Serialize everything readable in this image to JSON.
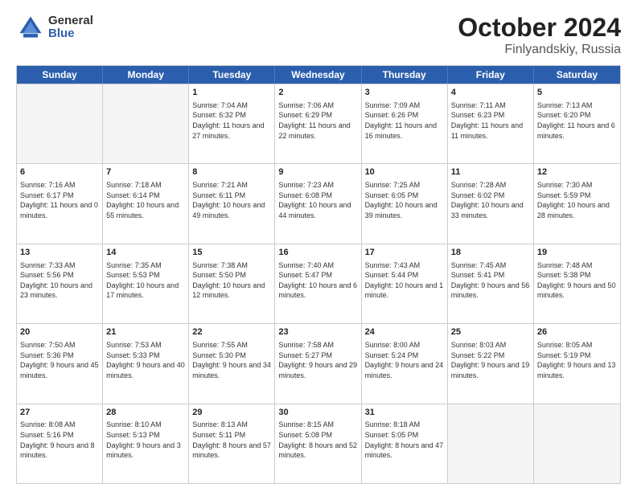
{
  "logo": {
    "general": "General",
    "blue": "Blue"
  },
  "title": {
    "month": "October 2024",
    "location": "Finlyandskiy, Russia"
  },
  "header_days": [
    "Sunday",
    "Monday",
    "Tuesday",
    "Wednesday",
    "Thursday",
    "Friday",
    "Saturday"
  ],
  "rows": [
    [
      {
        "day": "",
        "sunrise": "",
        "sunset": "",
        "daylight": "",
        "empty": true
      },
      {
        "day": "",
        "sunrise": "",
        "sunset": "",
        "daylight": "",
        "empty": true
      },
      {
        "day": "1",
        "sunrise": "Sunrise: 7:04 AM",
        "sunset": "Sunset: 6:32 PM",
        "daylight": "Daylight: 11 hours and 27 minutes.",
        "empty": false
      },
      {
        "day": "2",
        "sunrise": "Sunrise: 7:06 AM",
        "sunset": "Sunset: 6:29 PM",
        "daylight": "Daylight: 11 hours and 22 minutes.",
        "empty": false
      },
      {
        "day": "3",
        "sunrise": "Sunrise: 7:09 AM",
        "sunset": "Sunset: 6:26 PM",
        "daylight": "Daylight: 11 hours and 16 minutes.",
        "empty": false
      },
      {
        "day": "4",
        "sunrise": "Sunrise: 7:11 AM",
        "sunset": "Sunset: 6:23 PM",
        "daylight": "Daylight: 11 hours and 11 minutes.",
        "empty": false
      },
      {
        "day": "5",
        "sunrise": "Sunrise: 7:13 AM",
        "sunset": "Sunset: 6:20 PM",
        "daylight": "Daylight: 11 hours and 6 minutes.",
        "empty": false
      }
    ],
    [
      {
        "day": "6",
        "sunrise": "Sunrise: 7:16 AM",
        "sunset": "Sunset: 6:17 PM",
        "daylight": "Daylight: 11 hours and 0 minutes.",
        "empty": false
      },
      {
        "day": "7",
        "sunrise": "Sunrise: 7:18 AM",
        "sunset": "Sunset: 6:14 PM",
        "daylight": "Daylight: 10 hours and 55 minutes.",
        "empty": false
      },
      {
        "day": "8",
        "sunrise": "Sunrise: 7:21 AM",
        "sunset": "Sunset: 6:11 PM",
        "daylight": "Daylight: 10 hours and 49 minutes.",
        "empty": false
      },
      {
        "day": "9",
        "sunrise": "Sunrise: 7:23 AM",
        "sunset": "Sunset: 6:08 PM",
        "daylight": "Daylight: 10 hours and 44 minutes.",
        "empty": false
      },
      {
        "day": "10",
        "sunrise": "Sunrise: 7:25 AM",
        "sunset": "Sunset: 6:05 PM",
        "daylight": "Daylight: 10 hours and 39 minutes.",
        "empty": false
      },
      {
        "day": "11",
        "sunrise": "Sunrise: 7:28 AM",
        "sunset": "Sunset: 6:02 PM",
        "daylight": "Daylight: 10 hours and 33 minutes.",
        "empty": false
      },
      {
        "day": "12",
        "sunrise": "Sunrise: 7:30 AM",
        "sunset": "Sunset: 5:59 PM",
        "daylight": "Daylight: 10 hours and 28 minutes.",
        "empty": false
      }
    ],
    [
      {
        "day": "13",
        "sunrise": "Sunrise: 7:33 AM",
        "sunset": "Sunset: 5:56 PM",
        "daylight": "Daylight: 10 hours and 23 minutes.",
        "empty": false
      },
      {
        "day": "14",
        "sunrise": "Sunrise: 7:35 AM",
        "sunset": "Sunset: 5:53 PM",
        "daylight": "Daylight: 10 hours and 17 minutes.",
        "empty": false
      },
      {
        "day": "15",
        "sunrise": "Sunrise: 7:38 AM",
        "sunset": "Sunset: 5:50 PM",
        "daylight": "Daylight: 10 hours and 12 minutes.",
        "empty": false
      },
      {
        "day": "16",
        "sunrise": "Sunrise: 7:40 AM",
        "sunset": "Sunset: 5:47 PM",
        "daylight": "Daylight: 10 hours and 6 minutes.",
        "empty": false
      },
      {
        "day": "17",
        "sunrise": "Sunrise: 7:43 AM",
        "sunset": "Sunset: 5:44 PM",
        "daylight": "Daylight: 10 hours and 1 minute.",
        "empty": false
      },
      {
        "day": "18",
        "sunrise": "Sunrise: 7:45 AM",
        "sunset": "Sunset: 5:41 PM",
        "daylight": "Daylight: 9 hours and 56 minutes.",
        "empty": false
      },
      {
        "day": "19",
        "sunrise": "Sunrise: 7:48 AM",
        "sunset": "Sunset: 5:38 PM",
        "daylight": "Daylight: 9 hours and 50 minutes.",
        "empty": false
      }
    ],
    [
      {
        "day": "20",
        "sunrise": "Sunrise: 7:50 AM",
        "sunset": "Sunset: 5:36 PM",
        "daylight": "Daylight: 9 hours and 45 minutes.",
        "empty": false
      },
      {
        "day": "21",
        "sunrise": "Sunrise: 7:53 AM",
        "sunset": "Sunset: 5:33 PM",
        "daylight": "Daylight: 9 hours and 40 minutes.",
        "empty": false
      },
      {
        "day": "22",
        "sunrise": "Sunrise: 7:55 AM",
        "sunset": "Sunset: 5:30 PM",
        "daylight": "Daylight: 9 hours and 34 minutes.",
        "empty": false
      },
      {
        "day": "23",
        "sunrise": "Sunrise: 7:58 AM",
        "sunset": "Sunset: 5:27 PM",
        "daylight": "Daylight: 9 hours and 29 minutes.",
        "empty": false
      },
      {
        "day": "24",
        "sunrise": "Sunrise: 8:00 AM",
        "sunset": "Sunset: 5:24 PM",
        "daylight": "Daylight: 9 hours and 24 minutes.",
        "empty": false
      },
      {
        "day": "25",
        "sunrise": "Sunrise: 8:03 AM",
        "sunset": "Sunset: 5:22 PM",
        "daylight": "Daylight: 9 hours and 19 minutes.",
        "empty": false
      },
      {
        "day": "26",
        "sunrise": "Sunrise: 8:05 AM",
        "sunset": "Sunset: 5:19 PM",
        "daylight": "Daylight: 9 hours and 13 minutes.",
        "empty": false
      }
    ],
    [
      {
        "day": "27",
        "sunrise": "Sunrise: 8:08 AM",
        "sunset": "Sunset: 5:16 PM",
        "daylight": "Daylight: 9 hours and 8 minutes.",
        "empty": false
      },
      {
        "day": "28",
        "sunrise": "Sunrise: 8:10 AM",
        "sunset": "Sunset: 5:13 PM",
        "daylight": "Daylight: 9 hours and 3 minutes.",
        "empty": false
      },
      {
        "day": "29",
        "sunrise": "Sunrise: 8:13 AM",
        "sunset": "Sunset: 5:11 PM",
        "daylight": "Daylight: 8 hours and 57 minutes.",
        "empty": false
      },
      {
        "day": "30",
        "sunrise": "Sunrise: 8:15 AM",
        "sunset": "Sunset: 5:08 PM",
        "daylight": "Daylight: 8 hours and 52 minutes.",
        "empty": false
      },
      {
        "day": "31",
        "sunrise": "Sunrise: 8:18 AM",
        "sunset": "Sunset: 5:05 PM",
        "daylight": "Daylight: 8 hours and 47 minutes.",
        "empty": false
      },
      {
        "day": "",
        "sunrise": "",
        "sunset": "",
        "daylight": "",
        "empty": true
      },
      {
        "day": "",
        "sunrise": "",
        "sunset": "",
        "daylight": "",
        "empty": true
      }
    ]
  ]
}
